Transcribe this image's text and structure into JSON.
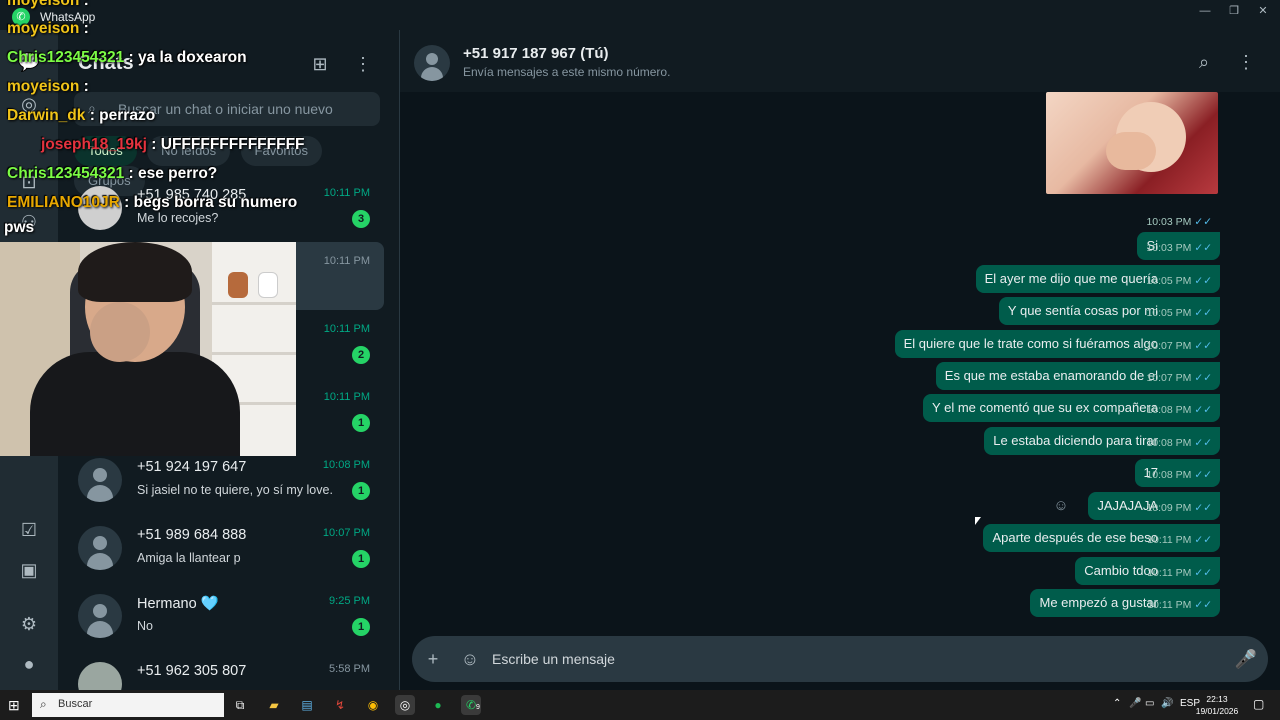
{
  "window": {
    "app_title": "WhatsApp",
    "controls": [
      "—",
      "❐",
      "✕"
    ]
  },
  "rail": {
    "icons": [
      "chats-icon",
      "status-icon",
      "channels-icon",
      "communities-icon",
      "starred-icon",
      "media-icon",
      "settings-icon",
      "profile-icon"
    ]
  },
  "chat_list": {
    "title": "Chats",
    "search_placeholder": "Buscar un chat o iniciar uno nuevo",
    "filters": [
      "Todos",
      "No leídos",
      "Favoritos",
      "Grupos"
    ],
    "items": [
      {
        "name": "+51 985 740 285",
        "preview": "Me lo recojes?",
        "time": "10:11 PM",
        "unread": "3"
      },
      {
        "name": "",
        "preview": "",
        "time": "10:11 PM",
        "unread": ""
      },
      {
        "name": "",
        "preview": "",
        "time": "10:11 PM",
        "unread": "2"
      },
      {
        "name": "",
        "preview": "",
        "time": "10:11 PM",
        "unread": "1"
      },
      {
        "name": "+51 924 197 647",
        "preview": "Si jasiel no te quiere, yo sí my love.",
        "time": "10:08 PM",
        "unread": "1"
      },
      {
        "name": "+51 989 684 888",
        "preview": "Amiga la llantear p",
        "time": "10:07 PM",
        "unread": "1"
      },
      {
        "name": "Hermano 🩵",
        "preview": "No",
        "time": "9:25 PM",
        "unread": "1"
      },
      {
        "name": "+51 962 305 807",
        "preview": "",
        "time": "5:58 PM",
        "unread": ""
      }
    ]
  },
  "conversation": {
    "name": "+51 917 187 967 (Tú)",
    "subtitle": "Envía mensajes a este mismo número.",
    "messages": [
      {
        "text": "",
        "time": "10:03 PM"
      },
      {
        "text": "Si",
        "time": "10:03 PM"
      },
      {
        "text": "El ayer me dijo que me quería",
        "time": "10:05 PM"
      },
      {
        "text": "Y que sentía cosas por mi",
        "time": "10:05 PM"
      },
      {
        "text": "El quiere que le trate como si fuéramos algo",
        "time": "10:07 PM"
      },
      {
        "text": "Es que me estaba enamorando de el",
        "time": "10:07 PM"
      },
      {
        "text": "Y el me comentó que su ex compañera",
        "time": "10:08 PM"
      },
      {
        "text": "Le estaba diciendo para tirar",
        "time": "10:08 PM"
      },
      {
        "text": "17",
        "time": "10:08 PM"
      },
      {
        "text": "JAJAJAJA",
        "time": "10:09 PM"
      },
      {
        "text": "Aparte después de ese beso",
        "time": "10:11 PM"
      },
      {
        "text": "Cambio tdoo",
        "time": "10:11 PM"
      },
      {
        "text": "Me empezó a gustar",
        "time": "10:11 PM"
      }
    ],
    "composer_placeholder": "Escribe un mensaje"
  },
  "stream_chat": [
    {
      "user": "moyeison",
      "text": "",
      "color": "#f0c419"
    },
    {
      "user": "Chris123454321",
      "text": "ya la doxearon",
      "color": "#7cfc45"
    },
    {
      "user": "moyeison",
      "text": "",
      "color": "#f0c419"
    },
    {
      "user": "Darwin_dk",
      "text": "perrazo",
      "color": "#f0c419"
    },
    {
      "user": "joseph18_19kj",
      "text": "UFFFFFFFFFFFFFF",
      "color": "#e5333f"
    },
    {
      "user": "Chris123454321",
      "text": "ese perro?",
      "color": "#7cfc45"
    },
    {
      "user": "EMILIANO10JR",
      "text": "begs borra su numero",
      "color": "#e8a800"
    },
    {
      "user": "pws",
      "text": "",
      "color": "#ffffff"
    }
  ],
  "taskbar": {
    "search_label": "Buscar",
    "tray_lang": "ESP",
    "clock_time": "22:13",
    "clock_date": "19/01/2026",
    "whatsapp_badge": "9"
  },
  "colors": {
    "accent": "#00a884",
    "bubble_out": "#005c4b",
    "badge": "#25d366",
    "read_ticks": "#53bdeb"
  }
}
